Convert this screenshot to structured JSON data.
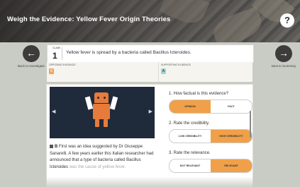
{
  "header": {
    "title": "Weigh the Evidence: Yellow Fever Origin Theories",
    "help_label": "?"
  },
  "nav": {
    "back_label": "Back to Investigate",
    "next_label": "Next to Summary"
  },
  "claim": {
    "label": "CLAIM",
    "number": "1",
    "text": "Yellow fever is spread by a bacteria called Bacillus Icteroides."
  },
  "evidence": {
    "opposing_label": "OPPOSING EVIDENCE",
    "opposing_tag": "8",
    "supporting_label": "SUPPORTING EVIDENCE",
    "supporting_tag": "A"
  },
  "passage": {
    "marker": "B",
    "text": "First was an idea suggested by Dr Giuseppe Sanarelli. A few years earlier this Italian researcher had announced that a type of bacteria called Bacillus Icteroides",
    "cut": "was the cause of yellow fever."
  },
  "questions": [
    {
      "prompt": "1. How factual is this evidence?",
      "left": "OPINION",
      "right": "FACT",
      "selected": "left"
    },
    {
      "prompt": "2. Rate the credibility.",
      "left": "LOW CREDIBILITY",
      "right": "HIGH CREDIBILITY",
      "selected": "right"
    },
    {
      "prompt": "3. Rate the relevance.",
      "left": "NOT RELEVANT",
      "right": "RELEVANT",
      "selected": "right"
    }
  ],
  "colors": {
    "accent": "#f0a048",
    "media_bg": "#1f2a3b",
    "robot": "#e77b3c"
  }
}
